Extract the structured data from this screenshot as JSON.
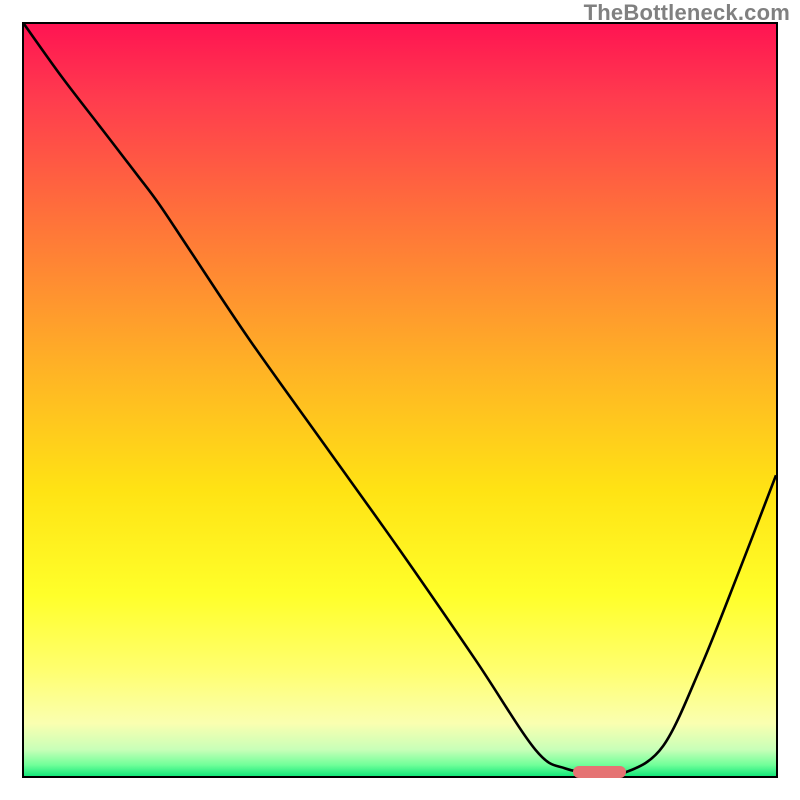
{
  "watermark": "TheBottleneck.com",
  "colors": {
    "gradient_top": "#ff1452",
    "gradient_mid": "#ffe314",
    "gradient_bottom": "#15e87a",
    "curve": "#000000",
    "marker": "#e57373"
  },
  "chart_data": {
    "type": "line",
    "title": "",
    "xlabel": "",
    "ylabel": "",
    "xlim": [
      0,
      100
    ],
    "ylim": [
      0,
      100
    ],
    "grid": false,
    "x": [
      0,
      5,
      10,
      15,
      18,
      22,
      30,
      40,
      50,
      60,
      68,
      72,
      76,
      80,
      85,
      90,
      95,
      100
    ],
    "values": [
      100,
      93,
      86.5,
      80,
      76,
      70,
      58,
      44,
      30,
      15.5,
      3.5,
      1,
      0.5,
      0.5,
      4,
      14.5,
      27,
      40
    ],
    "flat_region": {
      "x_from": 72,
      "x_to": 80,
      "y": 0.5
    },
    "marker": {
      "x_from": 73,
      "x_to": 80,
      "y": 0.5,
      "thickness": 1.6
    }
  }
}
